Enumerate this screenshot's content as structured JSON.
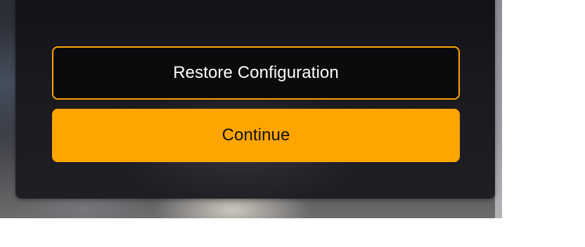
{
  "dialog": {
    "restore_button_label": "Restore Configuration",
    "continue_button_label": "Continue"
  },
  "colors": {
    "accent": "#ffa500",
    "dialog_background": "#1a1a1f",
    "restore_button_background": "#0b0b0d"
  }
}
